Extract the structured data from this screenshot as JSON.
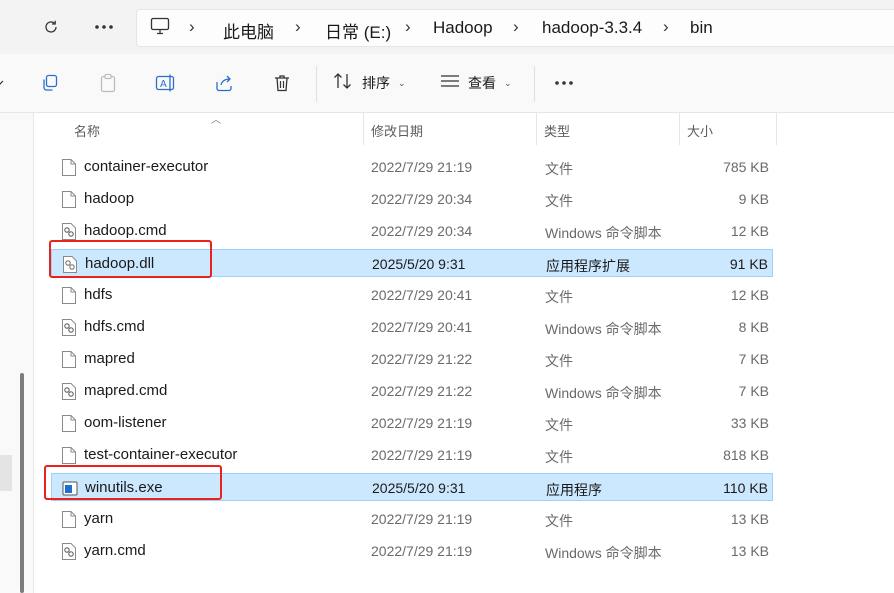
{
  "breadcrumb": {
    "items": [
      "此电脑",
      "日常 (E:)",
      "Hadoop",
      "hadoop-3.3.4",
      "bin"
    ]
  },
  "toolbar": {
    "sort_label": "排序",
    "view_label": "查看"
  },
  "columns": {
    "name": "名称",
    "modified": "修改日期",
    "type": "类型",
    "size": "大小"
  },
  "files": [
    {
      "name": "container-executor",
      "modified": "2022/7/29 21:19",
      "type": "文件",
      "size": "785 KB",
      "icon": "file-icon",
      "selected": false
    },
    {
      "name": "hadoop",
      "modified": "2022/7/29 20:34",
      "type": "文件",
      "size": "9 KB",
      "icon": "file-icon",
      "selected": false
    },
    {
      "name": "hadoop.cmd",
      "modified": "2022/7/29 20:34",
      "type": "Windows 命令脚本",
      "size": "12 KB",
      "icon": "script-icon",
      "selected": false
    },
    {
      "name": "hadoop.dll",
      "modified": "2025/5/20 9:31",
      "type": "应用程序扩展",
      "size": "91 KB",
      "icon": "dll-icon",
      "selected": true
    },
    {
      "name": "hdfs",
      "modified": "2022/7/29 20:41",
      "type": "文件",
      "size": "12 KB",
      "icon": "file-icon",
      "selected": false
    },
    {
      "name": "hdfs.cmd",
      "modified": "2022/7/29 20:41",
      "type": "Windows 命令脚本",
      "size": "8 KB",
      "icon": "script-icon",
      "selected": false
    },
    {
      "name": "mapred",
      "modified": "2022/7/29 21:22",
      "type": "文件",
      "size": "7 KB",
      "icon": "file-icon",
      "selected": false
    },
    {
      "name": "mapred.cmd",
      "modified": "2022/7/29 21:22",
      "type": "Windows 命令脚本",
      "size": "7 KB",
      "icon": "script-icon",
      "selected": false
    },
    {
      "name": "oom-listener",
      "modified": "2022/7/29 21:19",
      "type": "文件",
      "size": "33 KB",
      "icon": "file-icon",
      "selected": false
    },
    {
      "name": "test-container-executor",
      "modified": "2022/7/29 21:19",
      "type": "文件",
      "size": "818 KB",
      "icon": "file-icon",
      "selected": false
    },
    {
      "name": "winutils.exe",
      "modified": "2025/5/20 9:31",
      "type": "应用程序",
      "size": "110 KB",
      "icon": "exe-icon",
      "selected": true
    },
    {
      "name": "yarn",
      "modified": "2022/7/29 21:19",
      "type": "文件",
      "size": "13 KB",
      "icon": "file-icon",
      "selected": false
    },
    {
      "name": "yarn.cmd",
      "modified": "2022/7/29 21:19",
      "type": "Windows 命令脚本",
      "size": "13 KB",
      "icon": "script-icon",
      "selected": false
    }
  ],
  "colors": {
    "selection_fill": "#cce8ff",
    "selection_border": "#99d1ff",
    "highlight_box": "#e8221d"
  }
}
